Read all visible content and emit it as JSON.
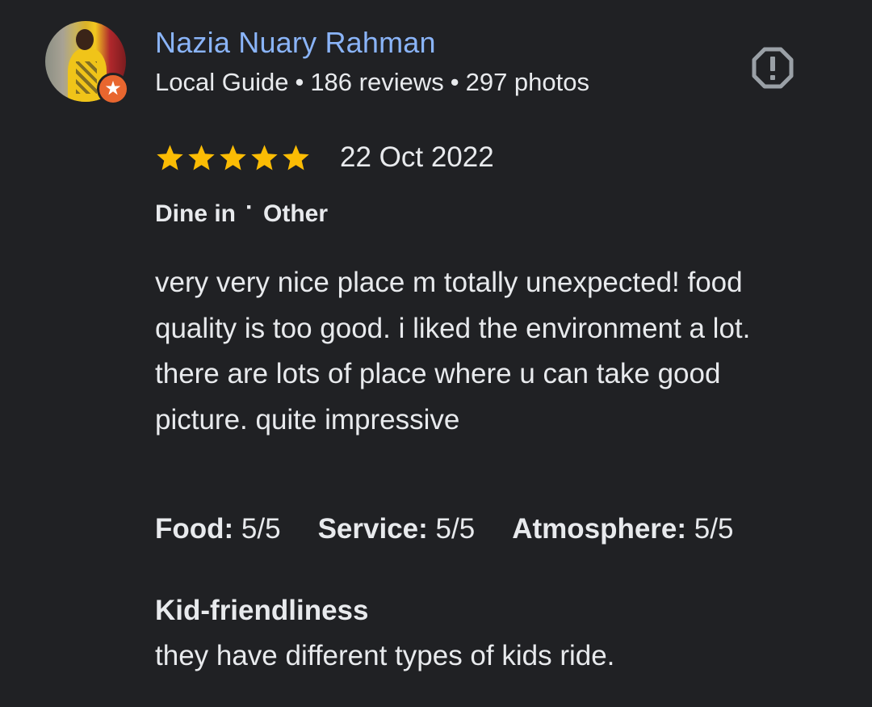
{
  "reviewer": {
    "name": "Nazia Nuary Rahman",
    "level": "Local Guide",
    "reviews": "186 reviews",
    "photos": "297 photos",
    "separator": "•"
  },
  "review": {
    "star_rating": 5,
    "max_stars": 5,
    "date": "22 Oct 2022",
    "tags": [
      "Dine in",
      "Other"
    ],
    "tag_separator": "·",
    "text": "very very nice place m totally unexpected! food quality is too good. i liked the environment a lot. there are lots of place where u can take good picture. quite impressive"
  },
  "ratings": [
    {
      "label": "Food:",
      "value": "5/5"
    },
    {
      "label": "Service:",
      "value": "5/5"
    },
    {
      "label": "Atmosphere:",
      "value": "5/5"
    }
  ],
  "kid_friendliness": {
    "title": "Kid-friendliness",
    "text": "they have different types of kids ride."
  },
  "icons": {
    "report": "report-flag-icon",
    "badge": "local-guide-badge-icon",
    "star": "star-icon"
  },
  "colors": {
    "background": "#202124",
    "name": "#8ab4f8",
    "text": "#e8eaed",
    "star": "#fbbc04",
    "badge": "#e8662f",
    "icon": "#9aa0a6"
  }
}
